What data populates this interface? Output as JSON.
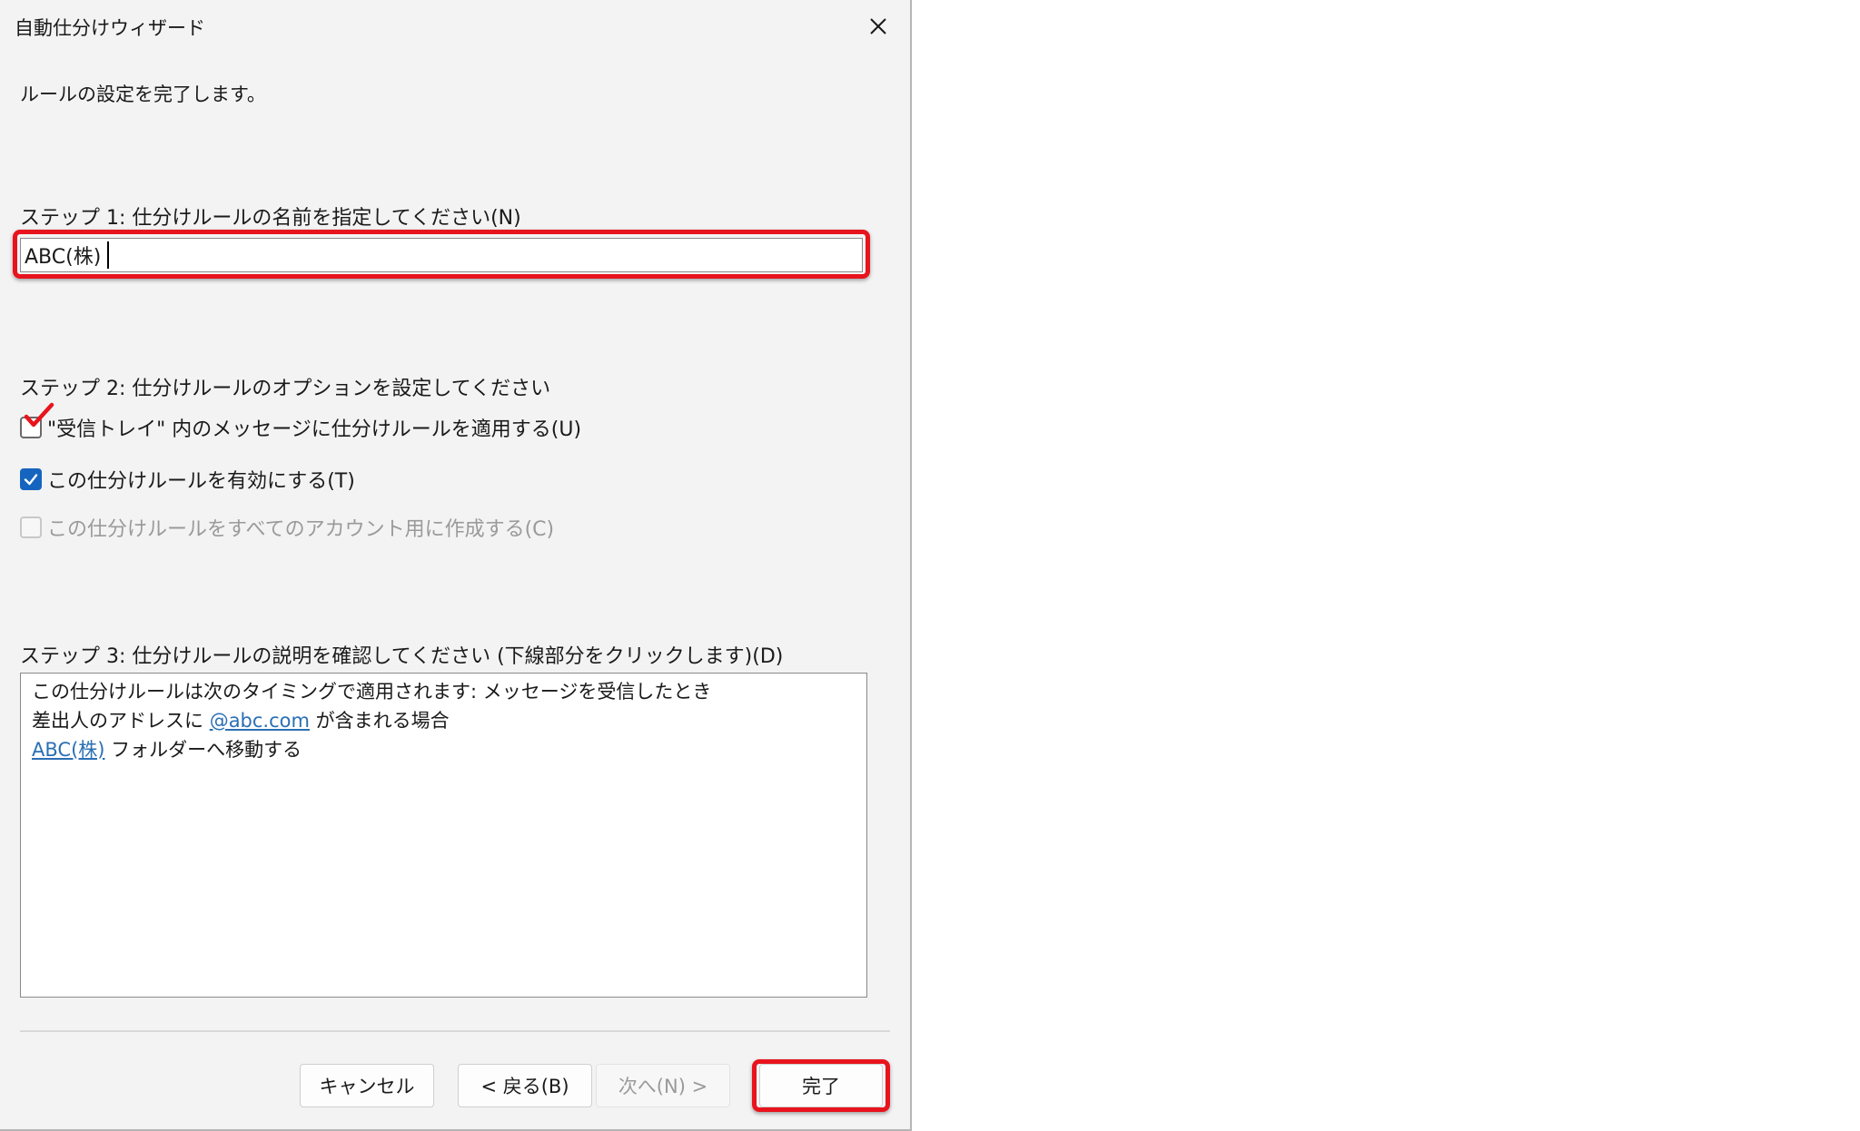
{
  "window": {
    "title": "自動仕分けウィザード",
    "close_icon": "close-icon"
  },
  "intro": "ルールの設定を完了します。",
  "step1": {
    "label": "ステップ 1: 仕分けルールの名前を指定してください(N)",
    "rule_name": "ABC(株)"
  },
  "step2": {
    "label": "ステップ 2: 仕分けルールのオプションを設定してください",
    "options": [
      {
        "label": "\"受信トレイ\" 内のメッセージに仕分けルールを適用する(U)",
        "checked": false,
        "enabled": true
      },
      {
        "label": "この仕分けルールを有効にする(T)",
        "checked": true,
        "enabled": true
      },
      {
        "label": "この仕分けルールをすべてのアカウント用に作成する(C)",
        "checked": false,
        "enabled": false
      }
    ]
  },
  "step3": {
    "label": "ステップ 3: 仕分けルールの説明を確認してください (下線部分をクリックします)(D)",
    "line1": "この仕分けルールは次のタイミングで適用されます: メッセージを受信したとき",
    "line2_prefix": "差出人のアドレスに",
    "line2_link": "@abc.com",
    "line2_suffix": "が含まれる場合",
    "line3_link": "ABC(株)",
    "line3_suffix": "フォルダーへ移動する"
  },
  "buttons": {
    "cancel": "キャンセル",
    "back": "< 戻る(B)",
    "next": "次へ(N) >",
    "finish": "完了"
  },
  "colors": {
    "highlight": "#e8141d",
    "checkbox_checked": "#1565c0",
    "link": "#2a6fb5",
    "dialog_bg": "#f3f3f3"
  }
}
